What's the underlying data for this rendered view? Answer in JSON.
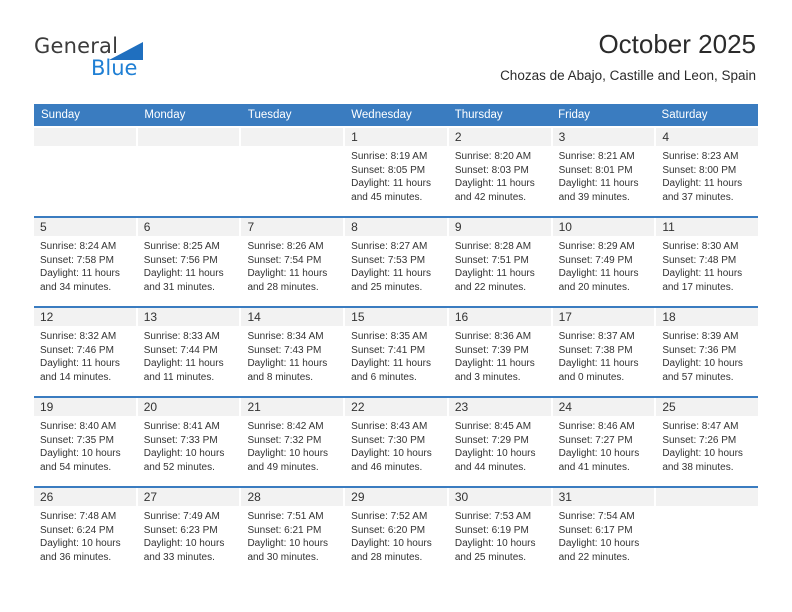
{
  "logo": {
    "primary_text": "General",
    "secondary_text": "Blue",
    "triangle_color": "#1f6fbf",
    "primary_color": "#3b3b3b",
    "secondary_color": "#1f7fd4"
  },
  "header": {
    "title": "October 2025",
    "subtitle": "Chozas de Abajo, Castille and Leon, Spain"
  },
  "theme": {
    "header_band": "#3a7cc0",
    "day_number_band": "#f2f2f2",
    "text": "#333333"
  },
  "weekdays": [
    "Sunday",
    "Monday",
    "Tuesday",
    "Wednesday",
    "Thursday",
    "Friday",
    "Saturday"
  ],
  "weeks": [
    [
      {
        "day": "",
        "empty": true
      },
      {
        "day": "",
        "empty": true
      },
      {
        "day": "",
        "empty": true
      },
      {
        "day": "1",
        "sunrise": "Sunrise: 8:19 AM",
        "sunset": "Sunset: 8:05 PM",
        "daylight": "Daylight: 11 hours and 45 minutes."
      },
      {
        "day": "2",
        "sunrise": "Sunrise: 8:20 AM",
        "sunset": "Sunset: 8:03 PM",
        "daylight": "Daylight: 11 hours and 42 minutes."
      },
      {
        "day": "3",
        "sunrise": "Sunrise: 8:21 AM",
        "sunset": "Sunset: 8:01 PM",
        "daylight": "Daylight: 11 hours and 39 minutes."
      },
      {
        "day": "4",
        "sunrise": "Sunrise: 8:23 AM",
        "sunset": "Sunset: 8:00 PM",
        "daylight": "Daylight: 11 hours and 37 minutes."
      }
    ],
    [
      {
        "day": "5",
        "sunrise": "Sunrise: 8:24 AM",
        "sunset": "Sunset: 7:58 PM",
        "daylight": "Daylight: 11 hours and 34 minutes."
      },
      {
        "day": "6",
        "sunrise": "Sunrise: 8:25 AM",
        "sunset": "Sunset: 7:56 PM",
        "daylight": "Daylight: 11 hours and 31 minutes."
      },
      {
        "day": "7",
        "sunrise": "Sunrise: 8:26 AM",
        "sunset": "Sunset: 7:54 PM",
        "daylight": "Daylight: 11 hours and 28 minutes."
      },
      {
        "day": "8",
        "sunrise": "Sunrise: 8:27 AM",
        "sunset": "Sunset: 7:53 PM",
        "daylight": "Daylight: 11 hours and 25 minutes."
      },
      {
        "day": "9",
        "sunrise": "Sunrise: 8:28 AM",
        "sunset": "Sunset: 7:51 PM",
        "daylight": "Daylight: 11 hours and 22 minutes."
      },
      {
        "day": "10",
        "sunrise": "Sunrise: 8:29 AM",
        "sunset": "Sunset: 7:49 PM",
        "daylight": "Daylight: 11 hours and 20 minutes."
      },
      {
        "day": "11",
        "sunrise": "Sunrise: 8:30 AM",
        "sunset": "Sunset: 7:48 PM",
        "daylight": "Daylight: 11 hours and 17 minutes."
      }
    ],
    [
      {
        "day": "12",
        "sunrise": "Sunrise: 8:32 AM",
        "sunset": "Sunset: 7:46 PM",
        "daylight": "Daylight: 11 hours and 14 minutes."
      },
      {
        "day": "13",
        "sunrise": "Sunrise: 8:33 AM",
        "sunset": "Sunset: 7:44 PM",
        "daylight": "Daylight: 11 hours and 11 minutes."
      },
      {
        "day": "14",
        "sunrise": "Sunrise: 8:34 AM",
        "sunset": "Sunset: 7:43 PM",
        "daylight": "Daylight: 11 hours and 8 minutes."
      },
      {
        "day": "15",
        "sunrise": "Sunrise: 8:35 AM",
        "sunset": "Sunset: 7:41 PM",
        "daylight": "Daylight: 11 hours and 6 minutes."
      },
      {
        "day": "16",
        "sunrise": "Sunrise: 8:36 AM",
        "sunset": "Sunset: 7:39 PM",
        "daylight": "Daylight: 11 hours and 3 minutes."
      },
      {
        "day": "17",
        "sunrise": "Sunrise: 8:37 AM",
        "sunset": "Sunset: 7:38 PM",
        "daylight": "Daylight: 11 hours and 0 minutes."
      },
      {
        "day": "18",
        "sunrise": "Sunrise: 8:39 AM",
        "sunset": "Sunset: 7:36 PM",
        "daylight": "Daylight: 10 hours and 57 minutes."
      }
    ],
    [
      {
        "day": "19",
        "sunrise": "Sunrise: 8:40 AM",
        "sunset": "Sunset: 7:35 PM",
        "daylight": "Daylight: 10 hours and 54 minutes."
      },
      {
        "day": "20",
        "sunrise": "Sunrise: 8:41 AM",
        "sunset": "Sunset: 7:33 PM",
        "daylight": "Daylight: 10 hours and 52 minutes."
      },
      {
        "day": "21",
        "sunrise": "Sunrise: 8:42 AM",
        "sunset": "Sunset: 7:32 PM",
        "daylight": "Daylight: 10 hours and 49 minutes."
      },
      {
        "day": "22",
        "sunrise": "Sunrise: 8:43 AM",
        "sunset": "Sunset: 7:30 PM",
        "daylight": "Daylight: 10 hours and 46 minutes."
      },
      {
        "day": "23",
        "sunrise": "Sunrise: 8:45 AM",
        "sunset": "Sunset: 7:29 PM",
        "daylight": "Daylight: 10 hours and 44 minutes."
      },
      {
        "day": "24",
        "sunrise": "Sunrise: 8:46 AM",
        "sunset": "Sunset: 7:27 PM",
        "daylight": "Daylight: 10 hours and 41 minutes."
      },
      {
        "day": "25",
        "sunrise": "Sunrise: 8:47 AM",
        "sunset": "Sunset: 7:26 PM",
        "daylight": "Daylight: 10 hours and 38 minutes."
      }
    ],
    [
      {
        "day": "26",
        "sunrise": "Sunrise: 7:48 AM",
        "sunset": "Sunset: 6:24 PM",
        "daylight": "Daylight: 10 hours and 36 minutes."
      },
      {
        "day": "27",
        "sunrise": "Sunrise: 7:49 AM",
        "sunset": "Sunset: 6:23 PM",
        "daylight": "Daylight: 10 hours and 33 minutes."
      },
      {
        "day": "28",
        "sunrise": "Sunrise: 7:51 AM",
        "sunset": "Sunset: 6:21 PM",
        "daylight": "Daylight: 10 hours and 30 minutes."
      },
      {
        "day": "29",
        "sunrise": "Sunrise: 7:52 AM",
        "sunset": "Sunset: 6:20 PM",
        "daylight": "Daylight: 10 hours and 28 minutes."
      },
      {
        "day": "30",
        "sunrise": "Sunrise: 7:53 AM",
        "sunset": "Sunset: 6:19 PM",
        "daylight": "Daylight: 10 hours and 25 minutes."
      },
      {
        "day": "31",
        "sunrise": "Sunrise: 7:54 AM",
        "sunset": "Sunset: 6:17 PM",
        "daylight": "Daylight: 10 hours and 22 minutes."
      },
      {
        "day": "",
        "empty": true
      }
    ]
  ]
}
